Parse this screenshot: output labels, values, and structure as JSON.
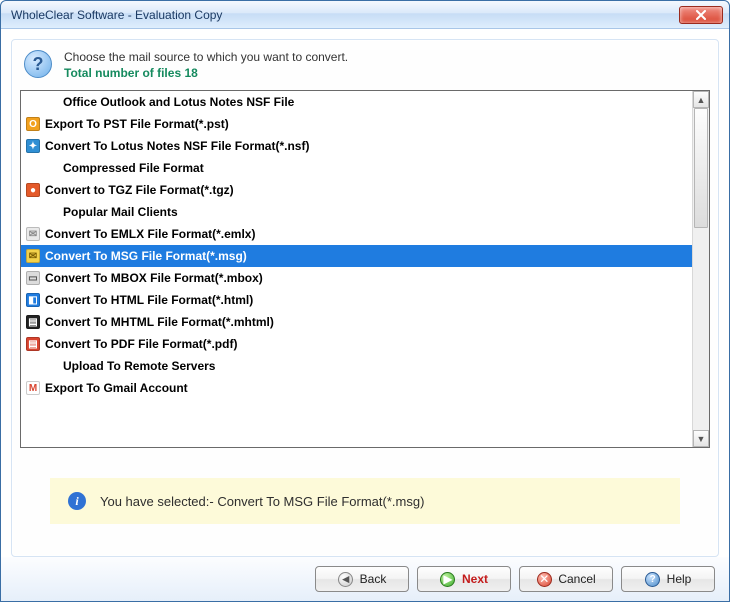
{
  "window": {
    "title": "WholeClear Software - Evaluation Copy"
  },
  "header": {
    "line1": "Choose the mail source to which you want to convert.",
    "line2": "Total number of files 18"
  },
  "list": {
    "selected_index": 6,
    "items": [
      {
        "kind": "heading",
        "icon": "",
        "label": "Office Outlook and Lotus Notes NSF File"
      },
      {
        "kind": "item",
        "icon": "pst",
        "label": "Export To PST File Format(*.pst)"
      },
      {
        "kind": "item",
        "icon": "nsf",
        "label": "Convert To Lotus Notes NSF File Format(*.nsf)"
      },
      {
        "kind": "heading",
        "icon": "",
        "label": "Compressed File Format"
      },
      {
        "kind": "item",
        "icon": "tgz",
        "label": "Convert to TGZ File Format(*.tgz)"
      },
      {
        "kind": "heading",
        "icon": "",
        "label": "Popular Mail Clients"
      },
      {
        "kind": "item",
        "icon": "emlx",
        "label": "Convert To EMLX File Format(*.emlx)"
      },
      {
        "kind": "item",
        "icon": "msg",
        "label": "Convert To MSG File Format(*.msg)"
      },
      {
        "kind": "item",
        "icon": "mbox",
        "label": "Convert To MBOX File Format(*.mbox)"
      },
      {
        "kind": "item",
        "icon": "html",
        "label": "Convert To HTML File Format(*.html)"
      },
      {
        "kind": "item",
        "icon": "mhtml",
        "label": "Convert To MHTML File Format(*.mhtml)"
      },
      {
        "kind": "item",
        "icon": "pdf",
        "label": "Convert To PDF File Format(*.pdf)"
      },
      {
        "kind": "heading",
        "icon": "",
        "label": "Upload To Remote Servers"
      },
      {
        "kind": "item",
        "icon": "gmail",
        "label": "Export To Gmail Account"
      }
    ]
  },
  "info": {
    "text": "You have selected:- Convert To MSG File Format(*.msg)"
  },
  "footer": {
    "back": "Back",
    "next": "Next",
    "cancel": "Cancel",
    "help": "Help"
  },
  "icons": {
    "pst": {
      "bg": "#f2a11e",
      "fg": "#fff",
      "glyph": "O"
    },
    "nsf": {
      "bg": "#2f8fd4",
      "fg": "#fff",
      "glyph": "✦"
    },
    "tgz": {
      "bg": "#e45a2a",
      "fg": "#fff",
      "glyph": "●"
    },
    "emlx": {
      "bg": "#eaeaea",
      "fg": "#888",
      "glyph": "✉"
    },
    "msg": {
      "bg": "#f4d24b",
      "fg": "#7a5b00",
      "glyph": "✉"
    },
    "mbox": {
      "bg": "#dcdcdc",
      "fg": "#555",
      "glyph": "▭"
    },
    "html": {
      "bg": "#1f7ce0",
      "fg": "#fff",
      "glyph": "◧"
    },
    "mhtml": {
      "bg": "#222",
      "fg": "#fff",
      "glyph": "▤"
    },
    "pdf": {
      "bg": "#d9442f",
      "fg": "#fff",
      "glyph": "▤"
    },
    "gmail": {
      "bg": "#fff",
      "fg": "#d9442f",
      "glyph": "M"
    }
  }
}
